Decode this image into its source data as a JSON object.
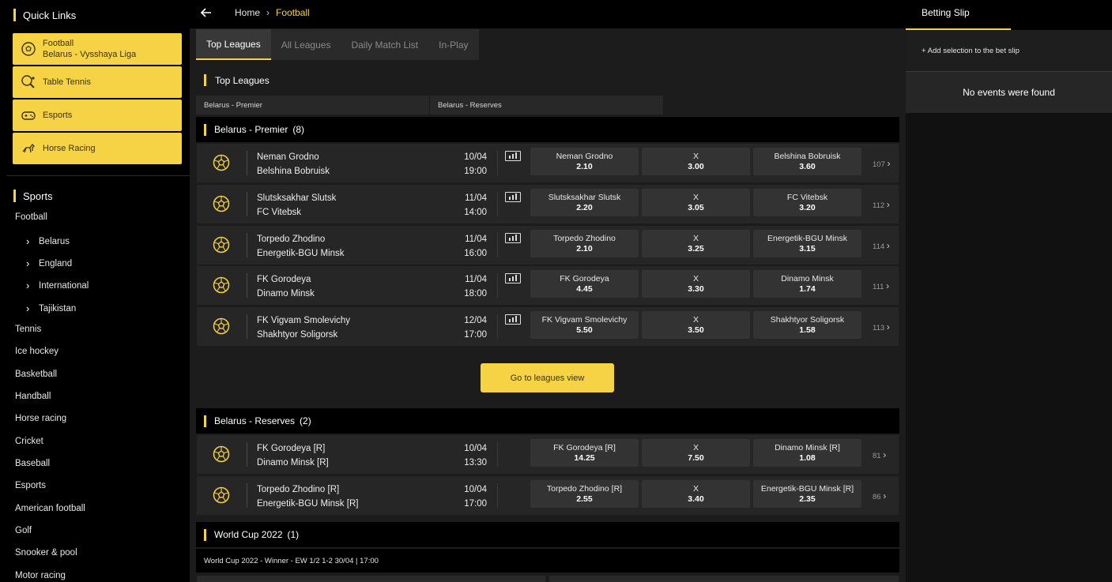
{
  "sidebar": {
    "quick_links_title": "Quick Links",
    "quick_links": [
      {
        "line1": "Football",
        "line2": "Belarus - Vysshaya Liga",
        "icon": "football-icon"
      },
      {
        "line1": "Table Tennis",
        "line2": "",
        "icon": "table-tennis-icon"
      },
      {
        "line1": "Esports",
        "line2": "",
        "icon": "gamepad-icon"
      },
      {
        "line1": "Horse Racing",
        "line2": "",
        "icon": "horse-icon"
      }
    ],
    "sports_title": "Sports",
    "sports": {
      "football": "Football",
      "belarus": "Belarus",
      "england": "England",
      "international": "International",
      "tajikistan": "Tajikistan",
      "tennis": "Tennis",
      "ice_hockey": "Ice hockey",
      "basketball": "Basketball",
      "handball": "Handball",
      "horse_racing": "Horse racing",
      "cricket": "Cricket",
      "baseball": "Baseball",
      "esports": "Esports",
      "american_football": "American football",
      "golf": "Golf",
      "snooker": "Snooker & pool",
      "motor_racing": "Motor racing"
    }
  },
  "breadcrumb": {
    "home": "Home",
    "current": "Football"
  },
  "tabs": [
    "Top Leagues",
    "All Leagues",
    "Daily Match List",
    "In-Play"
  ],
  "top_leagues": {
    "title": "Top Leagues",
    "chips": [
      "Belarus - Premier",
      "Belarus - Reserves"
    ]
  },
  "leagues": [
    {
      "name": "Belarus - Premier",
      "count": "(8)",
      "matches": [
        {
          "home": "Neman Grodno",
          "away": "Belshina Bobruisk",
          "date": "10/04",
          "time": "19:00",
          "o1_label": "Neman Grodno",
          "o1": "2.10",
          "ox_label": "X",
          "ox": "3.00",
          "o2_label": "Belshina Bobruisk",
          "o2": "3.60",
          "more": "107"
        },
        {
          "home": "Slutsksakhar Slutsk",
          "away": "FC Vitebsk",
          "date": "11/04",
          "time": "14:00",
          "o1_label": "Slutsksakhar Slutsk",
          "o1": "2.20",
          "ox_label": "X",
          "ox": "3.05",
          "o2_label": "FC Vitebsk",
          "o2": "3.20",
          "more": "112"
        },
        {
          "home": "Torpedo Zhodino",
          "away": "Energetik-BGU Minsk",
          "date": "11/04",
          "time": "16:00",
          "o1_label": "Torpedo Zhodino",
          "o1": "2.10",
          "ox_label": "X",
          "ox": "3.25",
          "o2_label": "Energetik-BGU Minsk",
          "o2": "3.15",
          "more": "114"
        },
        {
          "home": "FK Gorodeya",
          "away": "Dinamo Minsk",
          "date": "11/04",
          "time": "18:00",
          "o1_label": "FK Gorodeya",
          "o1": "4.45",
          "ox_label": "X",
          "ox": "3.30",
          "o2_label": "Dinamo Minsk",
          "o2": "1.74",
          "more": "111"
        },
        {
          "home": "FK Vigvam Smolevichy",
          "away": "Shakhtyor Soligorsk",
          "date": "12/04",
          "time": "17:00",
          "o1_label": "FK Vigvam Smolevichy",
          "o1": "5.50",
          "ox_label": "X",
          "ox": "3.50",
          "o2_label": "Shakhtyor Soligorsk",
          "o2": "1.58",
          "more": "113"
        }
      ]
    },
    {
      "name": "Belarus - Reserves",
      "count": "(2)",
      "matches": [
        {
          "home": "FK Gorodeya [R]",
          "away": "Dinamo Minsk [R]",
          "date": "10/04",
          "time": "13:30",
          "o1_label": "FK Gorodeya [R]",
          "o1": "14.25",
          "ox_label": "X",
          "ox": "7.50",
          "o2_label": "Dinamo Minsk [R]",
          "o2": "1.08",
          "more": "81"
        },
        {
          "home": "Torpedo Zhodino [R]",
          "away": "Energetik-BGU Minsk [R]",
          "date": "10/04",
          "time": "17:00",
          "o1_label": "Torpedo Zhodino [R]",
          "o1": "2.55",
          "ox_label": "X",
          "ox": "3.40",
          "o2_label": "Energetik-BGU Minsk [R]",
          "o2": "2.35",
          "more": "86"
        }
      ]
    },
    {
      "name": "World Cup 2022",
      "count": "(1)",
      "market": "World Cup 2022 - Winner - EW 1/2 1-2 30/04 | 17:00"
    }
  ],
  "go_leagues_label": "Go to leagues view",
  "betslip": {
    "title": "Betting Slip",
    "add_hint": "+ Add selection to the bet slip",
    "empty": "No events were found"
  },
  "colors": {
    "accent": "#f6d245",
    "background": "#1c1c1c",
    "panel": "#000000"
  }
}
